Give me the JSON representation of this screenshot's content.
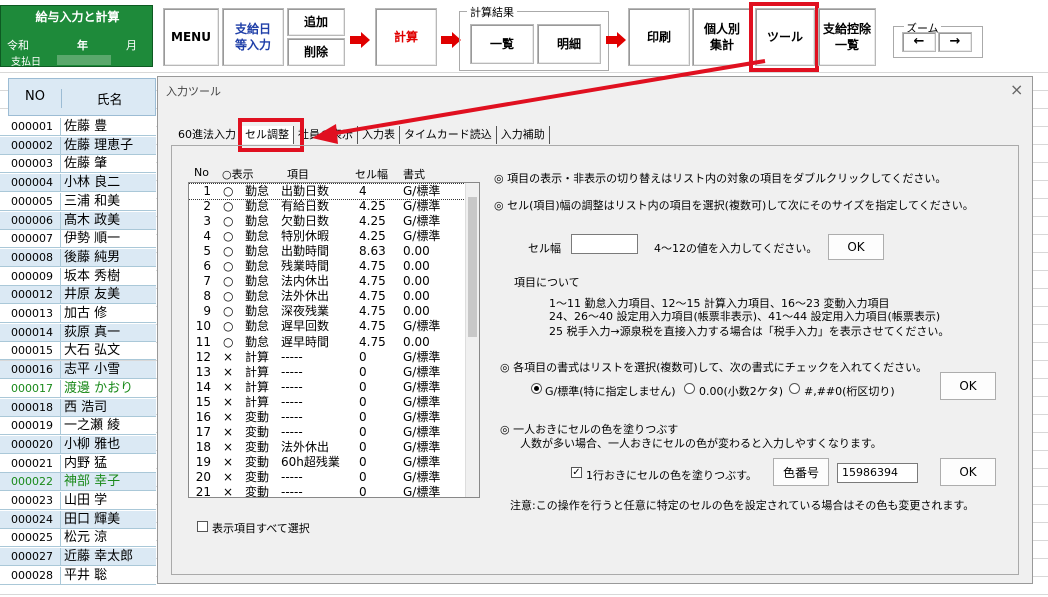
{
  "title_box": {
    "title": "給与入力と計算",
    "era": "令和",
    "year_label": "年",
    "month_label": "月",
    "pay_date": "支払日"
  },
  "toolbar": {
    "menu": "MENU",
    "pay_input": "支給日\n等入力",
    "add": "追加",
    "delete": "削除",
    "calc": "計算",
    "calc_result_label": "計算結果",
    "list": "一覧",
    "detail": "明細",
    "print": "印刷",
    "individual_total": "個人別\n集計",
    "tools": "ツール",
    "deduction_list": "支給控除\n一覧",
    "zoom_label": "ズーム",
    "zoom_left": "←",
    "zoom_right": "→"
  },
  "sheet": {
    "col_no": "NO",
    "col_name": "氏名",
    "rows": [
      {
        "no": "000001",
        "name": "佐藤 豊"
      },
      {
        "no": "000002",
        "name": "佐藤 理恵子"
      },
      {
        "no": "000003",
        "name": "佐藤 肇"
      },
      {
        "no": "000004",
        "name": "小林 良二"
      },
      {
        "no": "000005",
        "name": "三浦 和美"
      },
      {
        "no": "000006",
        "name": "髙木 政美"
      },
      {
        "no": "000007",
        "name": "伊勢 順一"
      },
      {
        "no": "000008",
        "name": "後藤 純男"
      },
      {
        "no": "000009",
        "name": "坂本 秀樹"
      },
      {
        "no": "000012",
        "name": "井原 友美"
      },
      {
        "no": "000013",
        "name": "加古 修"
      },
      {
        "no": "000014",
        "name": "荻原 真一"
      },
      {
        "no": "000015",
        "name": "大石 弘文"
      },
      {
        "no": "000016",
        "name": "志平 小雪"
      },
      {
        "no": "000017",
        "name": "渡邊 かおり"
      },
      {
        "no": "000018",
        "name": "西 浩司"
      },
      {
        "no": "000019",
        "name": "一之瀬 綾"
      },
      {
        "no": "000020",
        "name": "小柳 雅也"
      },
      {
        "no": "000021",
        "name": "内野 猛"
      },
      {
        "no": "000022",
        "name": "神部 幸子"
      },
      {
        "no": "000023",
        "name": "山田 学"
      },
      {
        "no": "000024",
        "name": "田口 輝美"
      },
      {
        "no": "000025",
        "name": "松元 涼"
      },
      {
        "no": "000027",
        "name": "近藤 幸太郎"
      },
      {
        "no": "000028",
        "name": "平井 聡"
      }
    ]
  },
  "dialog": {
    "title": "入力ツール",
    "close": "×",
    "tabs": [
      "60進法入力",
      "セル調整",
      "社員の表示",
      "入力表",
      "タイムカード読込",
      "入力補助"
    ],
    "list_headers": {
      "no": "No",
      "show": "○表示",
      "item": "項目",
      "width": "セル幅",
      "format": "書式"
    },
    "items": [
      {
        "no": "1",
        "mark": "○",
        "cat": "勤怠",
        "name": "出勤日数",
        "width": "4",
        "fmt": "G/標準"
      },
      {
        "no": "2",
        "mark": "○",
        "cat": "勤怠",
        "name": "有給日数",
        "width": "4.25",
        "fmt": "G/標準"
      },
      {
        "no": "3",
        "mark": "○",
        "cat": "勤怠",
        "name": "欠勤日数",
        "width": "4.25",
        "fmt": "G/標準"
      },
      {
        "no": "4",
        "mark": "○",
        "cat": "勤怠",
        "name": "特別休暇",
        "width": "4.25",
        "fmt": "G/標準"
      },
      {
        "no": "5",
        "mark": "○",
        "cat": "勤怠",
        "name": "出勤時間",
        "width": "8.63",
        "fmt": "0.00"
      },
      {
        "no": "6",
        "mark": "○",
        "cat": "勤怠",
        "name": "残業時間",
        "width": "4.75",
        "fmt": "0.00"
      },
      {
        "no": "7",
        "mark": "○",
        "cat": "勤怠",
        "name": "法内休出",
        "width": "4.75",
        "fmt": "0.00"
      },
      {
        "no": "8",
        "mark": "○",
        "cat": "勤怠",
        "name": "法外休出",
        "width": "4.75",
        "fmt": "0.00"
      },
      {
        "no": "9",
        "mark": "○",
        "cat": "勤怠",
        "name": "深夜残業",
        "width": "4.75",
        "fmt": "0.00"
      },
      {
        "no": "10",
        "mark": "○",
        "cat": "勤怠",
        "name": "遅早回数",
        "width": "4.75",
        "fmt": "G/標準"
      },
      {
        "no": "11",
        "mark": "○",
        "cat": "勤怠",
        "name": "遅早時間",
        "width": "4.75",
        "fmt": "0.00"
      },
      {
        "no": "12",
        "mark": "×",
        "cat": "計算",
        "name": "-----",
        "width": "0",
        "fmt": "G/標準"
      },
      {
        "no": "13",
        "mark": "×",
        "cat": "計算",
        "name": "-----",
        "width": "0",
        "fmt": "G/標準"
      },
      {
        "no": "14",
        "mark": "×",
        "cat": "計算",
        "name": "-----",
        "width": "0",
        "fmt": "G/標準"
      },
      {
        "no": "15",
        "mark": "×",
        "cat": "計算",
        "name": "-----",
        "width": "0",
        "fmt": "G/標準"
      },
      {
        "no": "16",
        "mark": "×",
        "cat": "変動",
        "name": "-----",
        "width": "0",
        "fmt": "G/標準"
      },
      {
        "no": "17",
        "mark": "×",
        "cat": "変動",
        "name": "-----",
        "width": "0",
        "fmt": "G/標準"
      },
      {
        "no": "18",
        "mark": "×",
        "cat": "変動",
        "name": "法外休出",
        "width": "0",
        "fmt": "G/標準"
      },
      {
        "no": "19",
        "mark": "×",
        "cat": "変動",
        "name": "60h超残業",
        "width": "0",
        "fmt": "G/標準"
      },
      {
        "no": "20",
        "mark": "×",
        "cat": "変動",
        "name": "-----",
        "width": "0",
        "fmt": "G/標準"
      },
      {
        "no": "21",
        "mark": "×",
        "cat": "変動",
        "name": "-----",
        "width": "0",
        "fmt": "G/標準"
      }
    ],
    "select_all": "表示項目すべて選択",
    "note1": "◎ 項目の表示・非表示の切り替えはリスト内の対象の項目をダブルクリックしてください。",
    "note2": "◎ セル(項目)幅の調整はリスト内の項目を選択(複数可)して次にそのサイズを指定してください。",
    "cell_width_label": "セル幅",
    "cell_width_value": "",
    "cell_width_hint": "4～12の値を入力してください。",
    "ok": "OK",
    "about_items": "項目について",
    "about1": "1～11  勤怠入力項目、12～15  計算入力項目、16～23  変動入力項目",
    "about2": "24、26～40 設定用入力項目(帳票非表示)、41～44 設定用入力項目(帳票表示)",
    "about3": "25 税手入力→源泉税を直接入力する場合は「税手入力」を表示させてください。",
    "fmt_note": "◎ 各項目の書式はリストを選択(複数可)して、次の書式にチェックを入れてください。",
    "fmt_opt1": "G/標準(特に指定しません)",
    "fmt_opt2": "0.00(小数2ケタ)",
    "fmt_opt3": "#,##0(桁区切り)",
    "alt_note1": "◎ 一人おきにセルの色を塗りつぶす",
    "alt_note2": "人数が多い場合、一人おきにセルの色が変わると入力しやすくなります。",
    "alt_check": "1行おきにセルの色を塗りつぶす。",
    "color_btn": "色番号",
    "color_value": "15986394",
    "caution": "注意:この操作を行うと任意に特定のセルの色を設定されている場合はその色も変更されます。"
  },
  "colors": {
    "accent_red": "#e01020",
    "title_green": "#1e8a3a",
    "row_blue": "#dbe9f4",
    "name_green": "#1a8a1a"
  }
}
